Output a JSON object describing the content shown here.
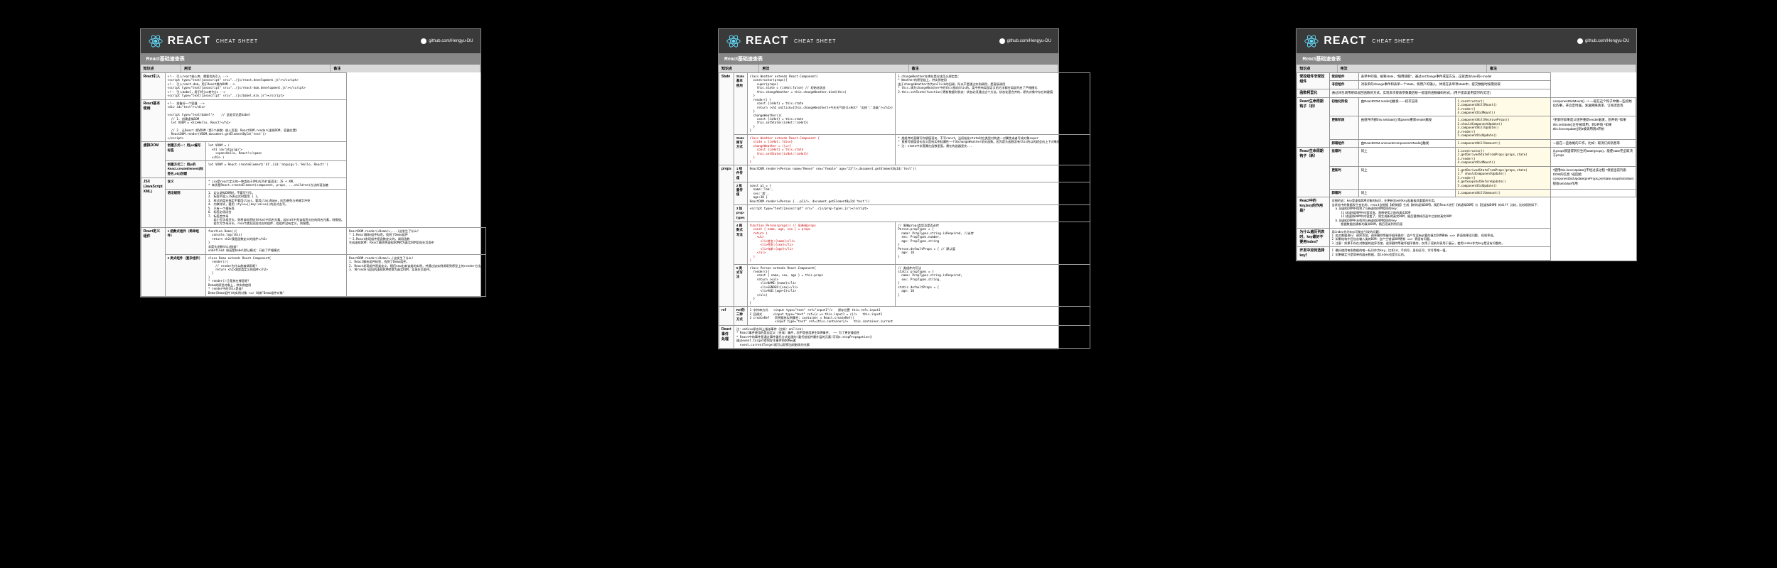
{
  "header": {
    "brand": "REACT",
    "subtitle": "CHEAT SHEET",
    "github": "github.com/Hengyu-DU"
  },
  "section_title": "React基础速查表",
  "columns": {
    "c1": "知识点",
    "c2": "用法",
    "c3": "备注"
  },
  "page1": {
    "rows": [
      {
        "label": "React引入",
        "code": "<!-- 引入react核心库，需要优先引入 -->\n<script type=\"text/javascript\" src=\"../js/react.development.js\"></script>\n<!-- 引入react-dom，用于React操作DOM -->\n<script type=\"text/javascript\" src=\"../js/react-dom.development.js\"></script>\n<!-- 引入babel，用于将jsx转为js -->\n<script type=\"text/javascript\" src=\"../js/babel.min.js\"></script>",
        "note": ""
      },
      {
        "label": "React基本使用",
        "code": "<!-- 准备好一个容器 -->\n<div id=\"test\"></div>\n\n<script type=\"text/babel\">    // 此处切记是babel\n  // 1. 创建虚拟DOM\n  let VDOM = <h1>Hello, React!</h1>\n\n  // 2. 让React 把VDOM（第1个参数）放入页面：ReactDOM.render(虚拟DOM, 容器位置)\n  ReactDOM.render(VDOM,document.getElementById('test'))\n</script>",
        "note": ""
      },
      {
        "label": "虚拟DOM",
        "subrows": [
          {
            "sub": "创建方式一：用jsx编写标签",
            "code": "let VDOM = (\n  <h1 id=\"atguigu\">\n    <span>Hello, React!</span>\n  </h1> )"
          },
          {
            "sub": "创建方式二：用js的React.createElement(标签名,obj)创建",
            "code": "let VDOM = React.createElement('h1',{id:'atguigu'},'Hello, React!')"
          }
        ]
      },
      {
        "label": "JSX (JavaScript XML)",
        "subrows": [
          {
            "sub": "含义",
            "code": "* jsx是react定义的一种类似于XML的JS扩展语法：JS + XML\n* 本质是React.createElement(component, props, ...children)方法的语法糖"
          },
          {
            "sub": "语法规则",
            "code": "1. 定义虚拟DOM时，不要写引号。\n2. 标签中混入JS表达式时要用 { }。\n3. 样式的类名指定不要用class，要用className，因为避免与关键字冲突\n4. 内联样式，要用 style={{key:value}}的形式去写。\n5. 只有一个根标签\n6. 标签必须闭合\n7. 标签首字母\n   若小写字母开头，则将该标签转为html中同名元素，若html中无该标签对应的同名元素，则报错。\n   若大写字母开头，react就去渲染对应的组件，若组件没有定义，则报错。"
          }
        ]
      },
      {
        "label": "React定义组件",
        "subrows": [
          {
            "sub": "1 函数式组件（简单组件）",
            "code": "function Demo(){\n  console.log(this)\n  return <h2>我是函数定义的组件</h2>\n}\n非箭头函数this指谁？\nundefined 原因是babel默认模式：开启了严格模式",
            "note": "ReactDOM.render(<Demo/>,...)这发生了什么？\n* 1.React解析组件标签，找到了Demo组件\n* 2.React发现组件是函数定义的，调用函数\n生成虚拟DOM: React最终将虚拟DOM转为真实DOM呈现在页面中"
          },
          {
            "sub": "2 类式组件（复杂组件）",
            "code": "class Demo extends React.Component{\n  render(){\n    // render为什么能被调用呢？\n    return <h2>我是类定义的组件</h2>\n  }\n}\n* render(){}是放在哪里呢？\nDemo的原型对象上，供实例使用\n* render中的this是谁？\nDemo(Demo组件)的实例对象 <=> 叫做\"Demo组件对象\"",
            "note": "ReactDOM.render(<Demo/>,)这发生了什么？\n1. React解析组件标签，找到了Demo组件。\n2. React发现组件是类定义，随后new出来该类的实例，并通过该实例调用到原型上的render方法。\n3. 将render返回的虚拟DOM转换为真实DOM，呈现在页面中。"
          }
        ]
      }
    ]
  },
  "page2": {
    "rows": [
      {
        "label": "State",
        "subrows": [
          {
            "sub": "State 基本使用",
            "code": "class Weather extends React.Component{\n  constructor(props){\n    super(props)\n    this.state = {isHot:false} // 初始化状态\n    this.changeWeather = this.changeWeather.bind(this)\n  }\n  render() {\n    const {isHot} = this.state\n    return (<h2 onClick={this.changeWeather}>今天天气很{isHot? '炎热':'凉爽'}</h2>)\n  }\n  changeWeather(){\n    const {isHot} = this.state\n    this.setState({isHot:!isHot})\n  }\n}",
            "note": "1.changeWeather在哪在是应该怎么绑定类：\n* Weather的原型链上，供实例使用\n由于changeWeather作为onClick的回调，所以不是通过实例调用，是直接调用\n* this.调为changeWeather中的this指向this的。类中所有局部定义的方法都在局部开启了严格模式\n2.this.setState(function)更新数据时状态：状态必须通过这个方法。状态化是合并的，原先对象中存在的键值"
          },
          {
            "sub": "State 简写方式",
            "code": "class Weather extends React.Component {\n  state = {isHot: false}\n  changeWeather = ()=>{\n    const {isHot} = this.state\n    this.setState({isHot:!isHot})\n  }\n}",
            "note": "* 类组件的直属写作赋值语句，不写const。当初始化state时在类里对构造一对属性或者写成对象super\n* 直接写赋值语句含义是给实例挂属性一个叫changeWeather前头函数。因为箭头函数没有this所以的就会向上下对象找，即该Weather实例\n* 注：state中非直属在函数里面，需在构造器里先..."
          }
        ]
      },
      {
        "label": "props",
        "subrows": [
          {
            "sub": "1 组件传值",
            "code": "ReactDOM.render(<Person name=\"Reese\" sex=\"female\" age=\"23\"/>,document.getElementById('test'))"
          },
          {
            "sub": "2 批量传值",
            "code": "const p1 = {\n  name:'Tom',\n  sex:'男',\n  age:30 }\nReactDOM.render(<Person {...p1}/>, document.getElementById('test'))"
          },
          {
            "sub": "3 加prop-types",
            "code": "<script type=\"text/javascript\" src=\"../js/prop-types.js\"></script>"
          },
          {
            "sub": "4 函数式写法",
            "code": "function Person(props){ // 形参给props\n  const { name, age, sex } = props\n  return (\n    <ul>\n      <li>姓名:{name}</li>\n      <li>性别:{sex}</li>\n      <li>年龄:{age}</li>\n    </ul>\n  )\n}",
            "note": "// 限制props类型及是否必传\nPerson.propTypes = {\n  name: PropTypes.string.isRequired, //必传\n  sex: PropTypes.number,\n  age: PropTypes.string\n}\nPerson.defaultProps = { // 默认值\n  age: 18\n}"
          },
          {
            "sub": "5 类式写法",
            "code": "class Person extends React.Component{\n  render(){\n    const { name, sex, age } = this.props\n    return (<ul>\n      <li>NAME:{name}</li>\n      <li>GENDER:{sex}</li>\n      <li>AGE:{age+1}</li>\n    </ul>)\n  }\n}",
            "note": "// 类组件内写法\nstatic propTypes = {\n  name: PropTypes.string.isRequired,\n  sex: PropTypes.string,\n}\nstatic defaultProps = {\n  age: 18\n}"
          }
        ]
      },
      {
        "label": "ref",
        "sub": "Ref的三种方式",
        "code": "1 字符串方式   <input type=\"text\" ref=\"input1\"/>   保存位置 this.refs.input1\n2 回调式      <input type=\"text\" ref={c => this.input1 = c}/>   this.input1\n3 createRef   声明赋给实例属性: container = React.createRef()\n              <input type=\"text\" ref={this.container}/>   this.container.current"
      },
      {
        "label": "React事件处理",
        "code": "注：onXxxx原名叫上指该事件（比如：onClick)\n* React事件使用的是自定义（合成）事件，而不是使用原生DOM事件， —— 为了更好兼容性\n* React中的事件是通过事件委托方式处理的(委托给组件最外层的元素)可用e.stopPropagation()\n通过event.target得到发生事件的DOM元素\n  event.currentTarget就可以获得当前触发的元素"
      }
    ]
  },
  "page3": {
    "rows": [
      {
        "label": "受控组件非受控组件",
        "subrows": [
          {
            "sub": "受控组件",
            "code": "表单中的值，被要state，\"随用随取\"，通过onChange事件或是方法，这就类似Vue的v-model"
          },
          {
            "sub": "非控组件",
            "code": "对表单的change事件和表单一个state，将用户的输入，体现在表单项state中，提交数据时按需读取"
          }
        ]
      },
      {
        "label": "函数柯里化",
        "code": "通过闭包调用继续返回函数的方式，实现多次接收参数最后统一处理的函数编码形式。(用于提高复用度时的灵活)"
      },
      {
        "label": "React生命周期钩子（旧）",
        "grid": [
          [
            "初始化阶段",
            "由ReactDOM.render()触发——初次渲染",
            "1.constructor()\n2.componentWillMount()\n3.render()\n4.componentDidMount()",
            "componentDidMount() --> 一般在这个钩子中做一些初始化的事，开启定时器，发送网络请求、订阅消息等"
          ],
          [
            "更新阶段",
            "由组件内部this.setState() 或parent重新render触发",
            "1.componentWillReceiveProps()\n2.shouldComponentUpdate()\n3.componentWillUpdate()\n4.render()\n5.componentDidUpdate()",
            "*更新时如果是父组件重新render触发，则开始\n*如果this.setState()正在被调用，则2开始\n*如果this.forceUpdate()则3被调用则3开始"
          ],
          [
            "卸载组件",
            "由ReactDOM.unmountComponentAtNode()触发",
            "1.componentWillUnmount()",
            "一般在一些收尾的工作，比如：取消订阅消息等"
          ]
        ]
      },
      {
        "label": "React生命周期钩子（新）",
        "grid": [
          [
            "挂载时",
            "同上",
            "1.constructor()\n2.getDerivedStateFromProps(props,state)\n3.render()\n4.componentDidMount()",
            "从props那里得到衍生的state(props)，能使state完全取决于props"
          ],
          [
            "更新时",
            "同上",
            "1.getDerivedStateFromProps(props,state)\n2.* shouldComponentUpdate()\n3.render()\n4.getSnapshotBeforeUpdate()\n5.componentDidUpdate()",
            "*使用this.forceUpdate()不经过该过程\n*保留当前列表DOM的信息\n*返回给componentDidUpdate(preProps,preState,snapshotValue) 接收setValue作用"
          ],
          [
            "卸载时",
            "同上",
            "1.componentWillUnmount()",
            ""
          ]
        ]
      },
      {
        "label": "React中的key,key的作用是？",
        "subtext": "简单的说：",
        "code": "详细的说：key是虚拟DOM对象的标识，在更新显示时key起着极其重要的作用。\n当状态中的数据发生变化时，react会根据【新数据】生成【新的虚拟DOM】，随后React进行【新虚拟DOM】与【旧虚拟DOM】的diff 比较，比较规则如下：\n  a.旧虚拟DOM中找到了与新虚拟DOM相同的key：\n     (1)若虚拟DOM中内容没变，直接使用之前的真实DOM\n     (2)若虚拟DOM中内容变了，则生成新的真实DOM，随后替换掉页面中之前的真实DOM\n  b.旧虚拟DOM中未找到与新虚拟DOM相同的key\n     根据数据创建新的真实DOM，随后渲染到到页面"
      },
      {
        "label": "为什么遍历列表时，key最好不要用index？",
        "code": "用index作为key可能会引发的问题：\n1 若对数据进行：逆序添加、逆序删除等破坏顺序操作：会产生没有必要的真实DOM更新 ==> 界面效果没问题, 但效率低。\n2 如果结构中还包含输入类的DOM：会产生错误DOM更新 ==> 界面有问题。\n3 注意：如果不存在对数据的逆序添加、逆序删除等破坏顺序操作，仅用于渲染列表用于展示，使用index作为key是没有问题的。"
      },
      {
        "label": "开发中如何选择key？",
        "code": "1 最好使用每条数据的唯一标识作为key，比如id、手机号、身份证号、学号等唯一值。\n2 如果确定只是简单的展示数据，用index也是可以的。"
      }
    ]
  }
}
